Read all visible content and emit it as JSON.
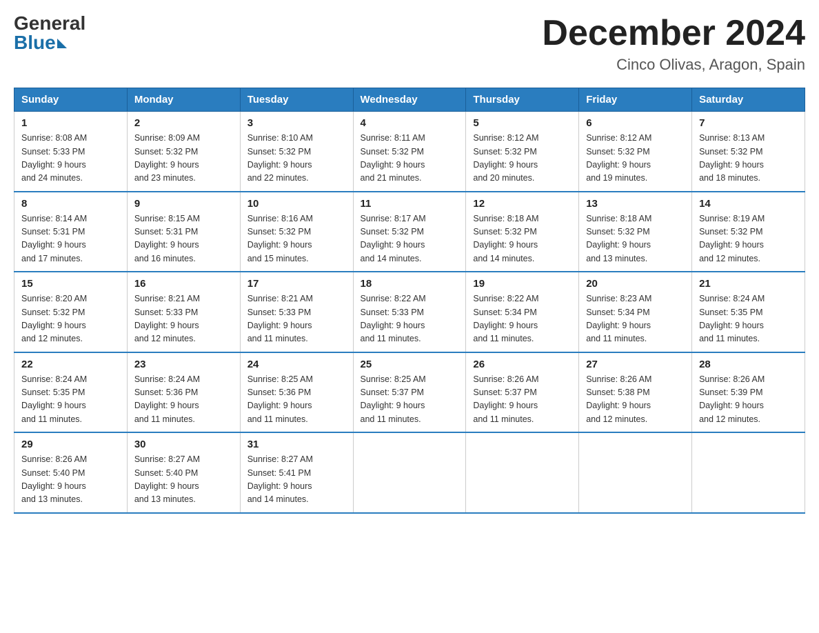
{
  "header": {
    "logo_general": "General",
    "logo_blue": "Blue",
    "month_title": "December 2024",
    "location": "Cinco Olivas, Aragon, Spain"
  },
  "calendar": {
    "days_of_week": [
      "Sunday",
      "Monday",
      "Tuesday",
      "Wednesday",
      "Thursday",
      "Friday",
      "Saturday"
    ],
    "weeks": [
      [
        {
          "day": "1",
          "sunrise": "8:08 AM",
          "sunset": "5:33 PM",
          "daylight": "9 hours and 24 minutes."
        },
        {
          "day": "2",
          "sunrise": "8:09 AM",
          "sunset": "5:32 PM",
          "daylight": "9 hours and 23 minutes."
        },
        {
          "day": "3",
          "sunrise": "8:10 AM",
          "sunset": "5:32 PM",
          "daylight": "9 hours and 22 minutes."
        },
        {
          "day": "4",
          "sunrise": "8:11 AM",
          "sunset": "5:32 PM",
          "daylight": "9 hours and 21 minutes."
        },
        {
          "day": "5",
          "sunrise": "8:12 AM",
          "sunset": "5:32 PM",
          "daylight": "9 hours and 20 minutes."
        },
        {
          "day": "6",
          "sunrise": "8:12 AM",
          "sunset": "5:32 PM",
          "daylight": "9 hours and 19 minutes."
        },
        {
          "day": "7",
          "sunrise": "8:13 AM",
          "sunset": "5:32 PM",
          "daylight": "9 hours and 18 minutes."
        }
      ],
      [
        {
          "day": "8",
          "sunrise": "8:14 AM",
          "sunset": "5:31 PM",
          "daylight": "9 hours and 17 minutes."
        },
        {
          "day": "9",
          "sunrise": "8:15 AM",
          "sunset": "5:31 PM",
          "daylight": "9 hours and 16 minutes."
        },
        {
          "day": "10",
          "sunrise": "8:16 AM",
          "sunset": "5:32 PM",
          "daylight": "9 hours and 15 minutes."
        },
        {
          "day": "11",
          "sunrise": "8:17 AM",
          "sunset": "5:32 PM",
          "daylight": "9 hours and 14 minutes."
        },
        {
          "day": "12",
          "sunrise": "8:18 AM",
          "sunset": "5:32 PM",
          "daylight": "9 hours and 14 minutes."
        },
        {
          "day": "13",
          "sunrise": "8:18 AM",
          "sunset": "5:32 PM",
          "daylight": "9 hours and 13 minutes."
        },
        {
          "day": "14",
          "sunrise": "8:19 AM",
          "sunset": "5:32 PM",
          "daylight": "9 hours and 12 minutes."
        }
      ],
      [
        {
          "day": "15",
          "sunrise": "8:20 AM",
          "sunset": "5:32 PM",
          "daylight": "9 hours and 12 minutes."
        },
        {
          "day": "16",
          "sunrise": "8:21 AM",
          "sunset": "5:33 PM",
          "daylight": "9 hours and 12 minutes."
        },
        {
          "day": "17",
          "sunrise": "8:21 AM",
          "sunset": "5:33 PM",
          "daylight": "9 hours and 11 minutes."
        },
        {
          "day": "18",
          "sunrise": "8:22 AM",
          "sunset": "5:33 PM",
          "daylight": "9 hours and 11 minutes."
        },
        {
          "day": "19",
          "sunrise": "8:22 AM",
          "sunset": "5:34 PM",
          "daylight": "9 hours and 11 minutes."
        },
        {
          "day": "20",
          "sunrise": "8:23 AM",
          "sunset": "5:34 PM",
          "daylight": "9 hours and 11 minutes."
        },
        {
          "day": "21",
          "sunrise": "8:24 AM",
          "sunset": "5:35 PM",
          "daylight": "9 hours and 11 minutes."
        }
      ],
      [
        {
          "day": "22",
          "sunrise": "8:24 AM",
          "sunset": "5:35 PM",
          "daylight": "9 hours and 11 minutes."
        },
        {
          "day": "23",
          "sunrise": "8:24 AM",
          "sunset": "5:36 PM",
          "daylight": "9 hours and 11 minutes."
        },
        {
          "day": "24",
          "sunrise": "8:25 AM",
          "sunset": "5:36 PM",
          "daylight": "9 hours and 11 minutes."
        },
        {
          "day": "25",
          "sunrise": "8:25 AM",
          "sunset": "5:37 PM",
          "daylight": "9 hours and 11 minutes."
        },
        {
          "day": "26",
          "sunrise": "8:26 AM",
          "sunset": "5:37 PM",
          "daylight": "9 hours and 11 minutes."
        },
        {
          "day": "27",
          "sunrise": "8:26 AM",
          "sunset": "5:38 PM",
          "daylight": "9 hours and 12 minutes."
        },
        {
          "day": "28",
          "sunrise": "8:26 AM",
          "sunset": "5:39 PM",
          "daylight": "9 hours and 12 minutes."
        }
      ],
      [
        {
          "day": "29",
          "sunrise": "8:26 AM",
          "sunset": "5:40 PM",
          "daylight": "9 hours and 13 minutes."
        },
        {
          "day": "30",
          "sunrise": "8:27 AM",
          "sunset": "5:40 PM",
          "daylight": "9 hours and 13 minutes."
        },
        {
          "day": "31",
          "sunrise": "8:27 AM",
          "sunset": "5:41 PM",
          "daylight": "9 hours and 14 minutes."
        },
        null,
        null,
        null,
        null
      ]
    ],
    "labels": {
      "sunrise": "Sunrise:",
      "sunset": "Sunset:",
      "daylight": "Daylight:"
    }
  }
}
